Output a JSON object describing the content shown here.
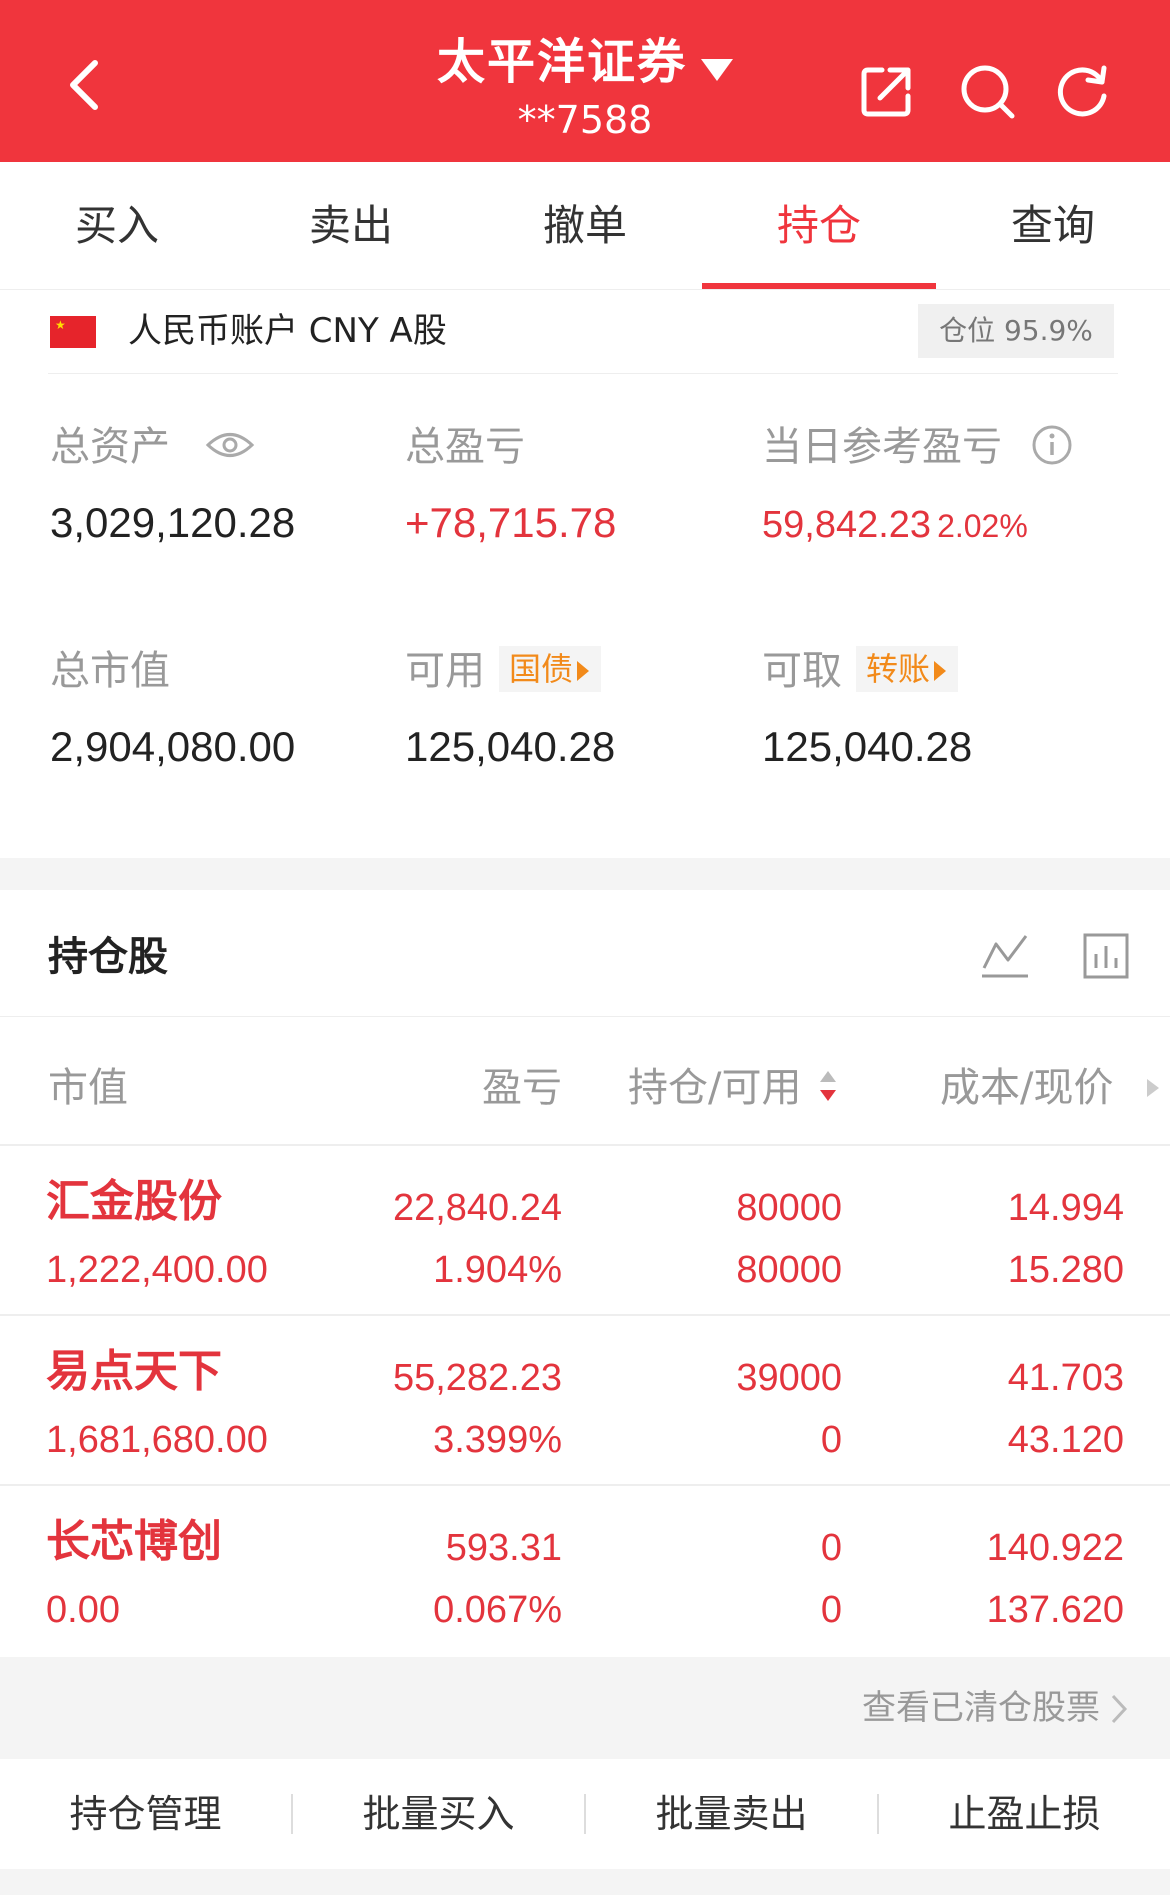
{
  "header": {
    "title": "太平洋证券",
    "account": "**7588"
  },
  "tabs": [
    {
      "label": "买入"
    },
    {
      "label": "卖出"
    },
    {
      "label": "撤单"
    },
    {
      "label": "持仓"
    },
    {
      "label": "查询"
    }
  ],
  "account_row": {
    "label": "人民币账户 CNY A股",
    "position": "仓位 95.9%"
  },
  "summary": {
    "total_assets_label": "总资产",
    "total_assets": "3,029,120.28",
    "total_pl_label": "总盈亏",
    "total_pl": "+78,715.78",
    "day_pl_label": "当日参考盈亏",
    "day_pl": "59,842.23",
    "day_pl_pct": "2.02%",
    "market_value_label": "总市值",
    "market_value": "2,904,080.00",
    "available_label": "可用",
    "available_tag": "国债",
    "available": "125,040.28",
    "withdrawable_label": "可取",
    "withdrawable_tag": "转账",
    "withdrawable": "125,040.28"
  },
  "holdings": {
    "title": "持仓股",
    "columns": [
      "市值",
      "盈亏",
      "持仓/可用",
      "成本/现价"
    ],
    "rows": [
      {
        "name": "汇金股份",
        "market_value": "1,222,400.00",
        "pl": "22,840.24",
        "pl_pct": "1.904%",
        "position": "80000",
        "available": "80000",
        "cost": "14.994",
        "price": "15.280"
      },
      {
        "name": "易点天下",
        "market_value": "1,681,680.00",
        "pl": "55,282.23",
        "pl_pct": "3.399%",
        "position": "39000",
        "available": "0",
        "cost": "41.703",
        "price": "43.120"
      },
      {
        "name": "长芯博创",
        "market_value": "0.00",
        "pl": "593.31",
        "pl_pct": "0.067%",
        "position": "0",
        "available": "0",
        "cost": "140.922",
        "price": "137.620"
      }
    ],
    "cleared_link": "查看已清仓股票"
  },
  "bottom_bar": [
    "持仓管理",
    "批量买入",
    "批量卖出",
    "止盈止损"
  ],
  "colors": {
    "brand": "#f0353d",
    "gain": "#e3343d",
    "tag": "#f28a1a"
  }
}
